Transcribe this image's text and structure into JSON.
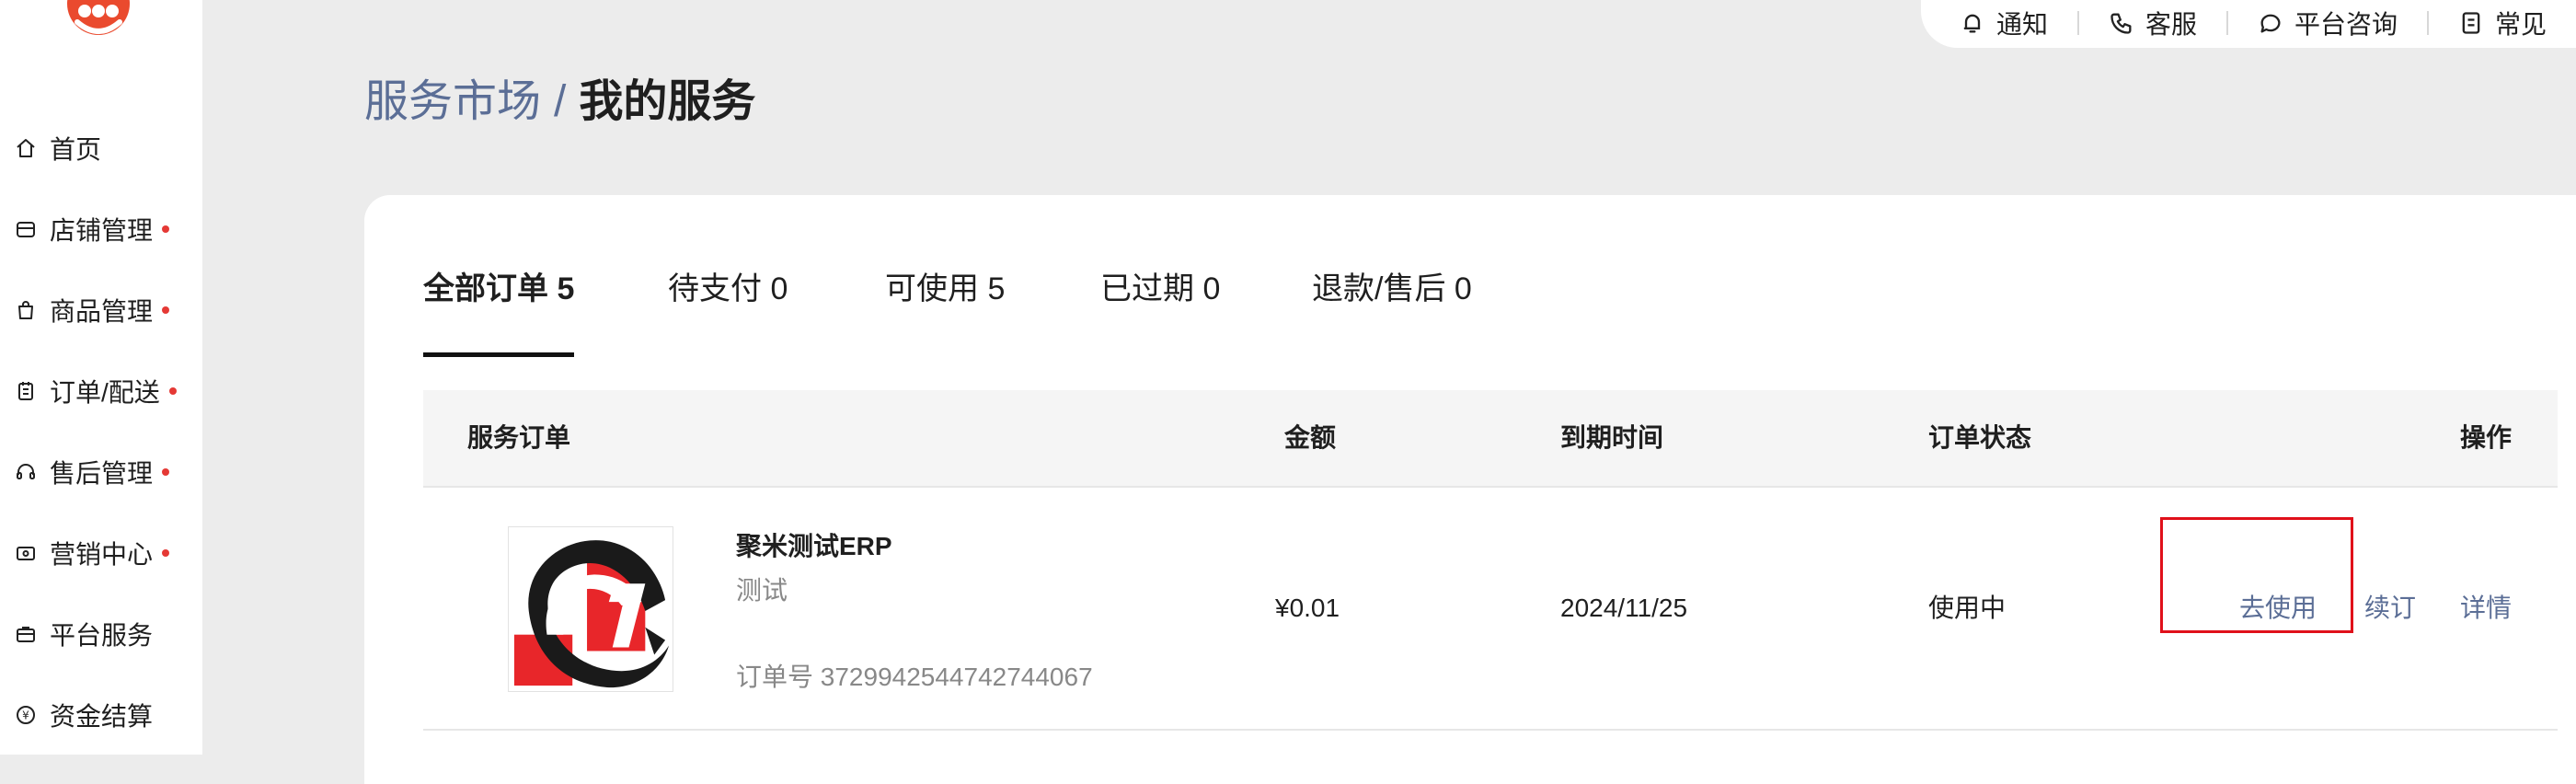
{
  "sidebar": {
    "items": [
      {
        "label": "首页",
        "icon": "home-icon",
        "dot": false
      },
      {
        "label": "店铺管理",
        "icon": "store-icon",
        "dot": true
      },
      {
        "label": "商品管理",
        "icon": "bag-icon",
        "dot": true
      },
      {
        "label": "订单/配送",
        "icon": "clipboard-icon",
        "dot": true
      },
      {
        "label": "售后管理",
        "icon": "headset-icon",
        "dot": true
      },
      {
        "label": "营销中心",
        "icon": "ticket-icon",
        "dot": true
      },
      {
        "label": "平台服务",
        "icon": "briefcase-icon",
        "dot": false
      },
      {
        "label": "资金结算",
        "icon": "yen-coin-icon",
        "dot": false
      }
    ],
    "dot_color": "#e53935"
  },
  "topbar": {
    "items": [
      {
        "label": "通知",
        "icon": "bell-icon"
      },
      {
        "label": "客服",
        "icon": "phone-icon"
      },
      {
        "label": "平台咨询",
        "icon": "chat-icon"
      },
      {
        "label": "常见",
        "icon": "document-icon"
      }
    ]
  },
  "breadcrumb": {
    "parent": "服务市场",
    "separator": "/",
    "current": "我的服务"
  },
  "tabs": [
    {
      "label": "全部订单 5",
      "active": true
    },
    {
      "label": "待支付 0",
      "active": false
    },
    {
      "label": "可使用 5",
      "active": false
    },
    {
      "label": "已过期 0",
      "active": false
    },
    {
      "label": "退款/售后 0",
      "active": false
    }
  ],
  "table": {
    "columns": [
      "服务订单",
      "金额",
      "到期时间",
      "订单状态",
      "操作"
    ],
    "rows": [
      {
        "name": "聚米测试ERP",
        "subtitle": "测试",
        "order_no": "订单号 3729942544742744067",
        "amount": "¥0.01",
        "expiry": "2024/11/25",
        "status": "使用中",
        "actions": [
          "去使用",
          "续订",
          "详情"
        ]
      }
    ]
  },
  "colors": {
    "link": "#5b6e96",
    "highlight": "#e0101a",
    "brand": "#ea4a2e"
  }
}
